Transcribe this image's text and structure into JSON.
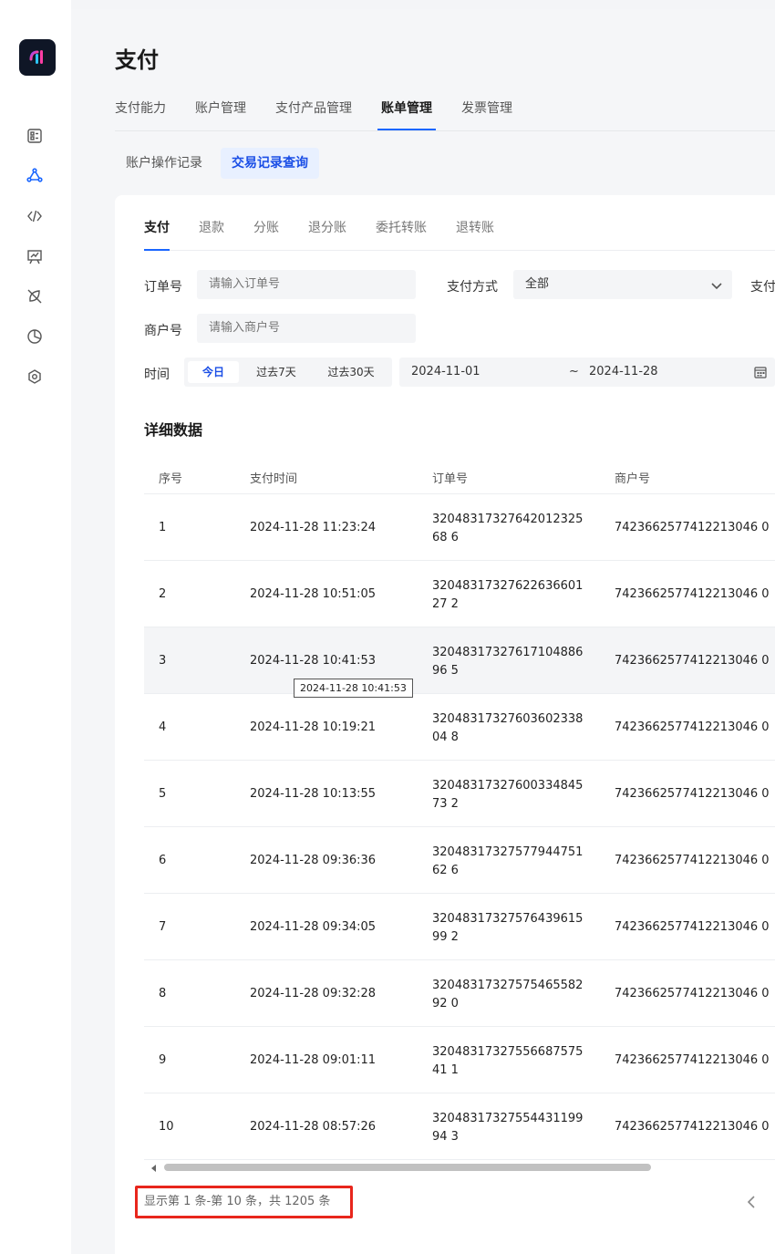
{
  "page": {
    "title": "支付"
  },
  "top_tabs": [
    {
      "label": "支付能力"
    },
    {
      "label": "账户管理"
    },
    {
      "label": "支付产品管理"
    },
    {
      "label": "账单管理",
      "active": true
    },
    {
      "label": "发票管理"
    }
  ],
  "sub_tabs": [
    {
      "label": "账户操作记录"
    },
    {
      "label": "交易记录查询",
      "active": true
    }
  ],
  "inner_tabs": [
    {
      "label": "支付",
      "active": true
    },
    {
      "label": "退款"
    },
    {
      "label": "分账"
    },
    {
      "label": "退分账"
    },
    {
      "label": "委托转账"
    },
    {
      "label": "退转账"
    }
  ],
  "filters": {
    "order_label": "订单号",
    "order_placeholder": "请输入订单号",
    "pay_method_label": "支付方式",
    "pay_method_value": "全部",
    "truncated_label": "支付",
    "merchant_label": "商户号",
    "merchant_placeholder": "请输入商户号",
    "time_label": "时间",
    "time_options": [
      "今日",
      "过去7天",
      "过去30天"
    ],
    "time_selected": "今日",
    "date_start": "2024-11-01",
    "date_sep": "~",
    "date_end": "2024-11-28"
  },
  "table": {
    "section_title": "详细数据",
    "columns": [
      "序号",
      "支付时间",
      "订单号",
      "商户号"
    ],
    "rows": [
      {
        "idx": "1",
        "time": "2024-11-28 11:23:24",
        "order": "3204831732764201232568 6",
        "merchant": "7423662577412213046 0"
      },
      {
        "idx": "2",
        "time": "2024-11-28 10:51:05",
        "order": "3204831732762263660127 2",
        "merchant": "7423662577412213046 0"
      },
      {
        "idx": "3",
        "time": "2024-11-28 10:41:53",
        "order": "3204831732761710488696 5",
        "merchant": "7423662577412213046 0"
      },
      {
        "idx": "4",
        "time": "2024-11-28 10:19:21",
        "order": "3204831732760360233804 8",
        "merchant": "7423662577412213046 0"
      },
      {
        "idx": "5",
        "time": "2024-11-28 10:13:55",
        "order": "3204831732760033484573 2",
        "merchant": "7423662577412213046 0"
      },
      {
        "idx": "6",
        "time": "2024-11-28 09:36:36",
        "order": "3204831732757794475162 6",
        "merchant": "7423662577412213046 0"
      },
      {
        "idx": "7",
        "time": "2024-11-28 09:34:05",
        "order": "3204831732757643961599 2",
        "merchant": "7423662577412213046 0"
      },
      {
        "idx": "8",
        "time": "2024-11-28 09:32:28",
        "order": "3204831732757546558292 0",
        "merchant": "7423662577412213046 0"
      },
      {
        "idx": "9",
        "time": "2024-11-28 09:01:11",
        "order": "3204831732755668757541 1",
        "merchant": "7423662577412213046 0"
      },
      {
        "idx": "10",
        "time": "2024-11-28 08:57:26",
        "order": "3204831732755443119994 3",
        "merchant": "7423662577412213046 0"
      }
    ]
  },
  "tooltip": {
    "text": "2024-11-28 10:41:53"
  },
  "pagination": {
    "summary": "显示第 1 条-第 10 条，共 1205 条"
  },
  "colors": {
    "accent": "#1a66ff",
    "highlight_box": "#e8261c"
  }
}
